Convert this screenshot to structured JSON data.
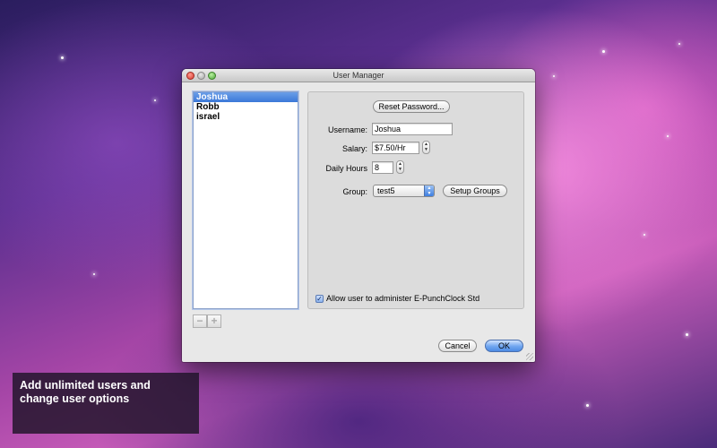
{
  "window": {
    "title": "User Manager"
  },
  "user_list": {
    "items": [
      "Joshua",
      "Robb",
      "israel"
    ],
    "selected": "Joshua"
  },
  "list_controls": {
    "remove_symbol": "−",
    "add_symbol": "+"
  },
  "form": {
    "reset_password_label": "Reset Password...",
    "username_label": "Username:",
    "username_value": "Joshua",
    "salary_label": "Salary:",
    "salary_value": "$7.50/Hr",
    "daily_hours_label": "Daily Hours",
    "daily_hours_value": "8",
    "group_label": "Group:",
    "group_value": "test5",
    "setup_groups_label": "Setup Groups",
    "admin_checkbox_label": "Allow user to administer E-PunchClock Std",
    "admin_checked": true
  },
  "footer": {
    "cancel_label": "Cancel",
    "ok_label": "OK"
  },
  "caption": {
    "text": "Add unlimited users and change user options"
  },
  "colors": {
    "selection": "#3b78d8",
    "default_button": "#6fa5ef"
  },
  "icons": {
    "stepper": "up-down-arrows",
    "select": "up-down-arrows",
    "check": "checkmark"
  }
}
